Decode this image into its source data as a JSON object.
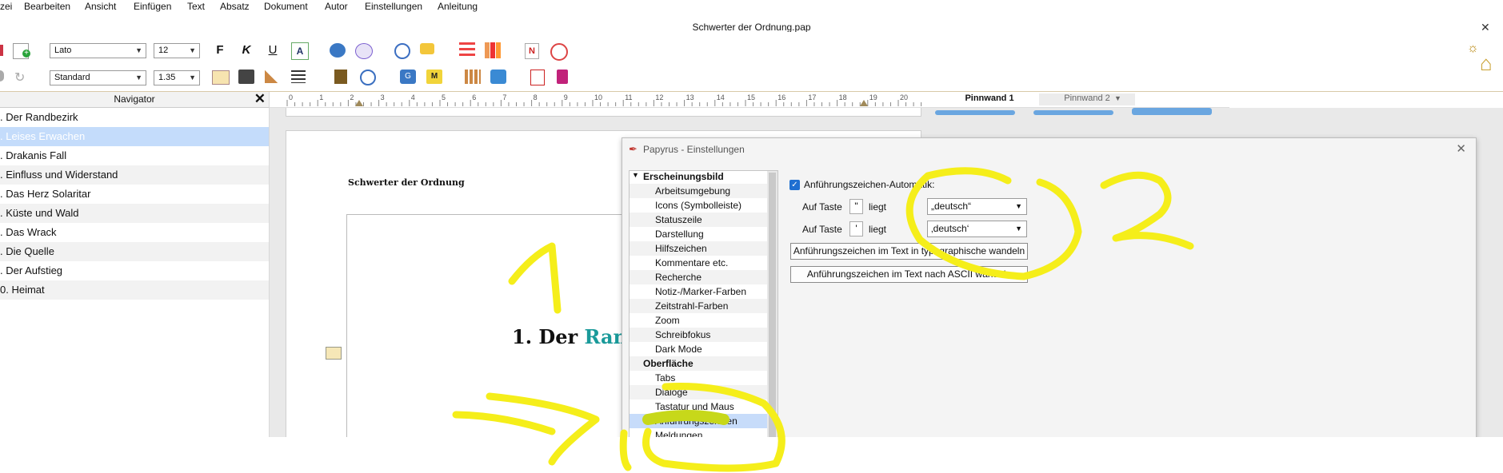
{
  "menu": [
    "zei",
    "Bearbeiten",
    "Ansicht",
    "Einfügen",
    "Text",
    "Absatz",
    "Dokument",
    "Autor",
    "Einstellungen",
    "Anleitung"
  ],
  "window": {
    "title": "Schwerter der Ordnung.pap",
    "close_glyph": "✕"
  },
  "toolbar": {
    "font_family": "Lato",
    "font_size": "12",
    "style": "Standard",
    "line_spacing": "1.35",
    "bold": "F",
    "italic": "K",
    "underline": "U"
  },
  "navigator": {
    "title": "Navigator",
    "items": [
      ". Der Randbezirk",
      ". Leises Erwachen",
      ". Drakanis Fall",
      ". Einfluss und Widerstand",
      ". Das Herz Solaritar",
      ". Küste und Wald",
      ". Das Wrack",
      ". Die Quelle",
      ". Der Aufstieg",
      "0. Heimat"
    ],
    "selected_index": 1
  },
  "ruler": {
    "numbers": [
      "0",
      "1",
      "2",
      "3",
      "4",
      "5",
      "6",
      "7",
      "8",
      "9",
      "10",
      "11",
      "12",
      "13",
      "14",
      "15",
      "16",
      "17",
      "18",
      "19",
      "20"
    ],
    "tab1": "Pinnwand 1",
    "tab2": "Pinnwand 2"
  },
  "document": {
    "header": "Schwerter der Ordnung",
    "heading_prefix": "1. Der ",
    "heading_colored": "Rand",
    "heading_color": "#1a9a9a"
  },
  "dialog": {
    "title": "Papyrus - Einstellungen",
    "tree": [
      {
        "label": "Erscheinungsbild",
        "type": "head"
      },
      {
        "label": "Arbeitsumgebung",
        "type": "child"
      },
      {
        "label": "Icons (Symbolleiste)",
        "type": "child"
      },
      {
        "label": "Statuszeile",
        "type": "child"
      },
      {
        "label": "Darstellung",
        "type": "child"
      },
      {
        "label": "Hilfszeichen",
        "type": "child"
      },
      {
        "label": "Kommentare etc.",
        "type": "child"
      },
      {
        "label": "Recherche",
        "type": "child"
      },
      {
        "label": "Notiz-/Marker-Farben",
        "type": "child"
      },
      {
        "label": "Zeitstrahl-Farben",
        "type": "child"
      },
      {
        "label": "Zoom",
        "type": "child"
      },
      {
        "label": "Schreibfokus",
        "type": "child"
      },
      {
        "label": "Dark Mode",
        "type": "child"
      },
      {
        "label": "Oberfläche",
        "type": "head"
      },
      {
        "label": "Tabs",
        "type": "child"
      },
      {
        "label": "Dialoge",
        "type": "child"
      },
      {
        "label": "Tastatur und Maus",
        "type": "child"
      },
      {
        "label": "Anführungszeichen",
        "type": "child",
        "selected": true
      },
      {
        "label": "Meldungen",
        "type": "child"
      }
    ],
    "auto_checkbox_label": "Anführungszeichen-Automatik:",
    "key_label": "Auf Taste",
    "lies_label": "liegt",
    "key1": "\"",
    "key2": "'",
    "combo1": "„deutsch“",
    "combo2": "‚deutsch‘",
    "btn_typographic": "Anführungszeichen im Text in typographische wandeln",
    "btn_ascii": "Anführungszeichen im Text nach ASCII wandeln"
  },
  "annotations": {
    "color": "#f5ee1a",
    "label1": "1",
    "label2": "2",
    "label3": "3"
  }
}
